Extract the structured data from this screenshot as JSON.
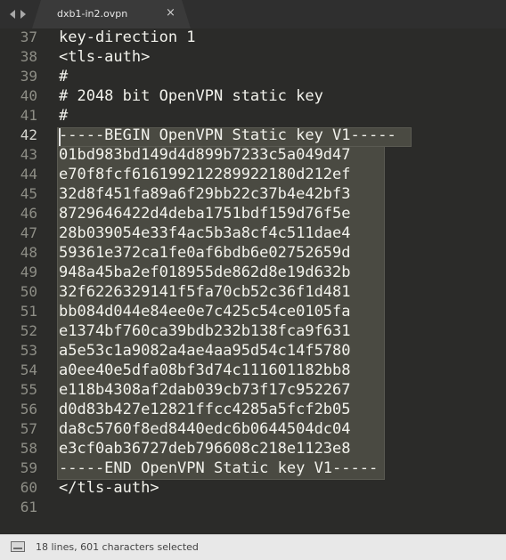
{
  "window": {
    "tab_title": "dxb1-in2.ovpn",
    "close_glyph": "×"
  },
  "editor": {
    "lines": [
      {
        "num": "37",
        "text": "key-direction 1"
      },
      {
        "num": "38",
        "text": "<tls-auth>"
      },
      {
        "num": "39",
        "text": "#"
      },
      {
        "num": "40",
        "text": "# 2048 bit OpenVPN static key"
      },
      {
        "num": "41",
        "text": "#"
      },
      {
        "num": "42",
        "text": "-----BEGIN OpenVPN Static key V1-----"
      },
      {
        "num": "43",
        "text": "01bd983bd149d4d899b7233c5a049d47"
      },
      {
        "num": "44",
        "text": "e70f8fcf616199212289922180d212ef"
      },
      {
        "num": "45",
        "text": "32d8f451fa89a6f29bb22c37b4e42bf3"
      },
      {
        "num": "46",
        "text": "8729646422d4deba1751bdf159d76f5e"
      },
      {
        "num": "47",
        "text": "28b039054e33f4ac5b3a8cf4c511dae4"
      },
      {
        "num": "48",
        "text": "59361e372ca1fe0af6bdb6e02752659d"
      },
      {
        "num": "49",
        "text": "948a45ba2ef018955de862d8e19d632b"
      },
      {
        "num": "50",
        "text": "32f6226329141f5fa70cb52c36f1d481"
      },
      {
        "num": "51",
        "text": "bb084d044e84ee0e7c425c54ce0105fa"
      },
      {
        "num": "52",
        "text": "e1374bf760ca39bdb232b138fca9f631"
      },
      {
        "num": "53",
        "text": "a5e53c1a9082a4ae4aa95d54c14f5780"
      },
      {
        "num": "54",
        "text": "a0ee40e5dfa08bf3d74c111601182bb8"
      },
      {
        "num": "55",
        "text": "e118b4308af2dab039cb73f17c952267"
      },
      {
        "num": "56",
        "text": "d0d83b427e12821ffcc4285a5fcf2b05"
      },
      {
        "num": "57",
        "text": "da8c5760f8ed8440edc6b0644504dc04"
      },
      {
        "num": "58",
        "text": "e3cf0ab36727deb796608c218e1123e8"
      },
      {
        "num": "59",
        "text": "-----END OpenVPN Static key V1-----"
      },
      {
        "num": "60",
        "text": "</tls-auth>"
      },
      {
        "num": "61",
        "text": ""
      }
    ]
  },
  "statusbar": {
    "text": "18 lines, 601 characters selected"
  },
  "colors": {
    "editor_bg": "#2b2b29",
    "selection": "#4a4a42",
    "text": "#f2f2ec",
    "gutter_text": "#8e8e86"
  }
}
